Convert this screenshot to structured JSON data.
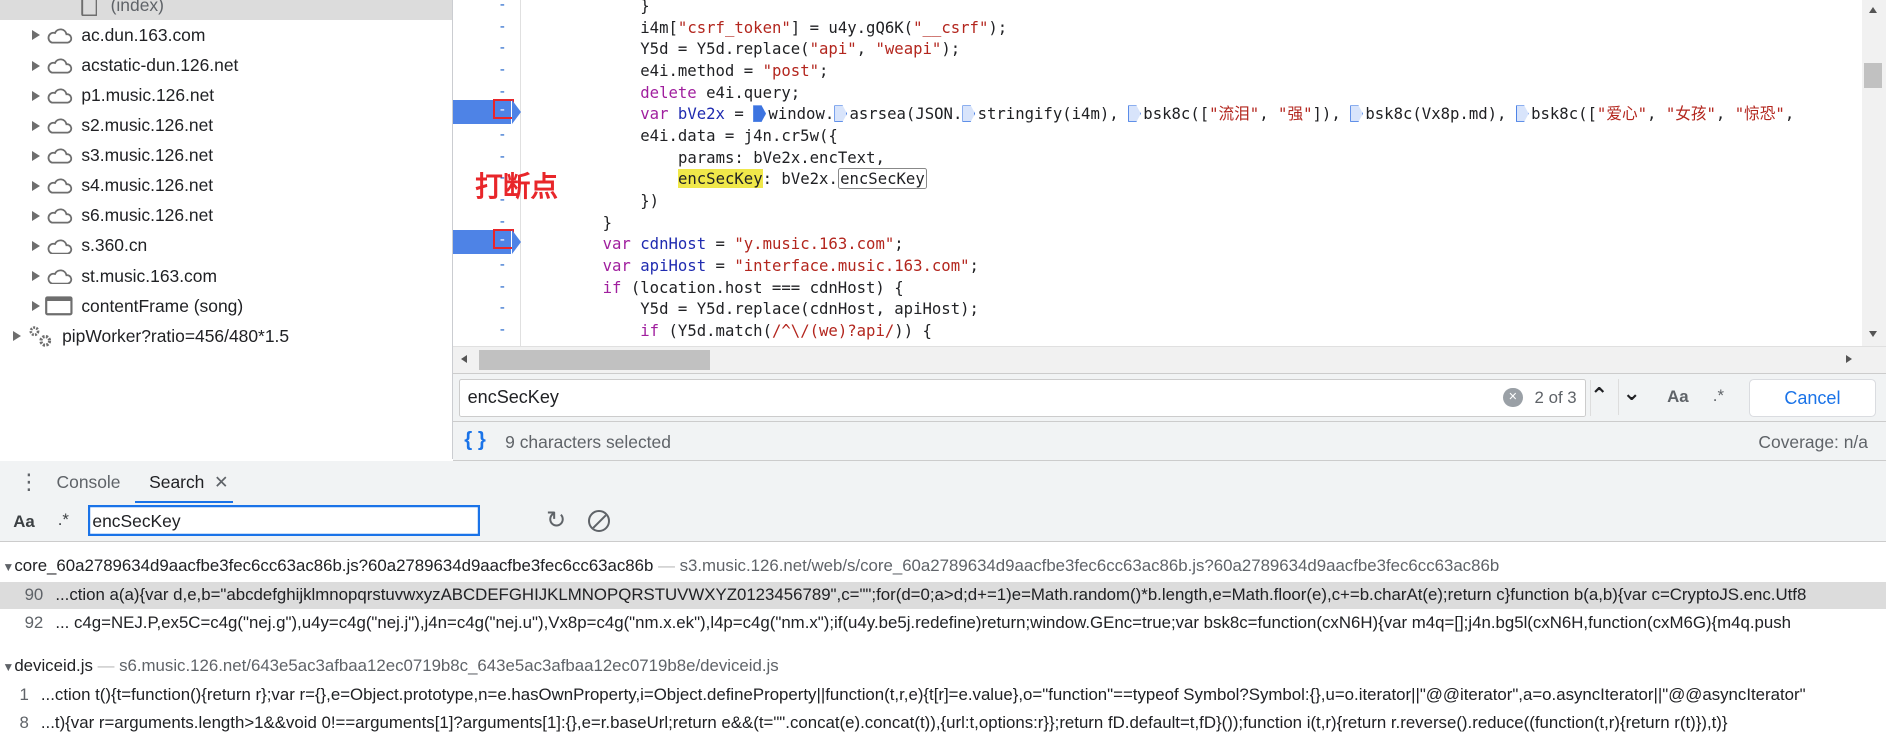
{
  "sidebar": {
    "items": [
      {
        "label": "(index)",
        "icon": "file-icon",
        "selected": true
      },
      {
        "label": "ac.dun.163.com",
        "icon": "cloud-icon"
      },
      {
        "label": "acstatic-dun.126.net",
        "icon": "cloud-icon"
      },
      {
        "label": "p1.music.126.net",
        "icon": "cloud-icon"
      },
      {
        "label": "s2.music.126.net",
        "icon": "cloud-icon"
      },
      {
        "label": "s3.music.126.net",
        "icon": "cloud-icon"
      },
      {
        "label": "s4.music.126.net",
        "icon": "cloud-icon"
      },
      {
        "label": "s6.music.126.net",
        "icon": "cloud-icon"
      },
      {
        "label": "s.360.cn",
        "icon": "cloud-icon"
      },
      {
        "label": "st.music.163.com",
        "icon": "cloud-icon"
      },
      {
        "label": "contentFrame (song)",
        "icon": "frame-icon"
      },
      {
        "label": "pipWorker?ratio=456/480*1.5",
        "icon": "gears-icon"
      }
    ]
  },
  "editor": {
    "annotation": "打断点",
    "lines": [
      {
        "indent": 4,
        "tokens": [
          [
            "",
            "}"
          ]
        ]
      },
      {
        "indent": 4,
        "tokens": [
          [
            "",
            "i4m["
          ],
          [
            "str",
            "\"csrf_token\""
          ],
          [
            "",
            "] = u4y.gQ6K("
          ],
          [
            "str",
            "\"__csrf\""
          ],
          [
            "",
            ");"
          ]
        ]
      },
      {
        "indent": 4,
        "tokens": [
          [
            "",
            "Y5d = Y5d.replace("
          ],
          [
            "str",
            "\"api\""
          ],
          [
            "",
            ", "
          ],
          [
            "str",
            "\"weapi\""
          ],
          [
            "",
            ");"
          ]
        ]
      },
      {
        "indent": 4,
        "tokens": [
          [
            "",
            "e4i.method = "
          ],
          [
            "str",
            "\"post\""
          ],
          [
            "",
            ";"
          ]
        ]
      },
      {
        "indent": 4,
        "tokens": [
          [
            "kw",
            "delete"
          ],
          [
            "",
            " e4i.query;"
          ]
        ]
      },
      {
        "indent": 4,
        "breakpoint": true,
        "tokens": [
          [
            "kw",
            "var"
          ],
          [
            "",
            " "
          ],
          [
            "def",
            "bVe2x"
          ],
          [
            "",
            " = "
          ],
          [
            "bpon",
            ""
          ],
          [
            "",
            "window."
          ],
          [
            "bp",
            ""
          ],
          [
            "",
            "asrsea(JSON."
          ],
          [
            "bp",
            ""
          ],
          [
            "",
            "stringify(i4m), "
          ],
          [
            "bp",
            ""
          ],
          [
            "",
            "bsk8c(["
          ],
          [
            "str",
            "\"流泪\""
          ],
          [
            "",
            ", "
          ],
          [
            "str",
            "\"强\""
          ],
          [
            "",
            "]), "
          ],
          [
            "bp",
            ""
          ],
          [
            "",
            "bsk8c(Vx8p.md), "
          ],
          [
            "bp",
            ""
          ],
          [
            "",
            "bsk8c(["
          ],
          [
            "str",
            "\"爱心\""
          ],
          [
            "",
            ", "
          ],
          [
            "str",
            "\"女孩\""
          ],
          [
            "",
            ", "
          ],
          [
            "str",
            "\"惊恐\""
          ],
          [
            "",
            ", "
          ]
        ]
      },
      {
        "indent": 4,
        "tokens": [
          [
            "",
            "e4i.data = j4n.cr5w({"
          ]
        ]
      },
      {
        "indent": 8,
        "tokens": [
          [
            "",
            "params: bVe2x.encText,"
          ]
        ]
      },
      {
        "indent": 8,
        "tokens": [
          [
            "hl",
            "encSecKey"
          ],
          [
            "",
            ": bVe2x."
          ],
          [
            "box",
            "encSecKey"
          ]
        ]
      },
      {
        "indent": 4,
        "tokens": [
          [
            "",
            "})"
          ]
        ]
      },
      {
        "indent": 0,
        "tokens": [
          [
            "",
            "}"
          ]
        ]
      },
      {
        "indent": 0,
        "breakpoint": true,
        "tokens": [
          [
            "kw",
            "var"
          ],
          [
            "",
            " "
          ],
          [
            "def",
            "cdnHost"
          ],
          [
            "",
            " = "
          ],
          [
            "str",
            "\"y.music.163.com\""
          ],
          [
            "",
            ";"
          ]
        ]
      },
      {
        "indent": 0,
        "tokens": [
          [
            "kw",
            "var"
          ],
          [
            "",
            " "
          ],
          [
            "def",
            "apiHost"
          ],
          [
            "",
            " = "
          ],
          [
            "str",
            "\"interface.music.163.com\""
          ],
          [
            "",
            ";"
          ]
        ]
      },
      {
        "indent": 0,
        "tokens": [
          [
            "kw",
            "if"
          ],
          [
            "",
            " (location.host === cdnHost) {"
          ]
        ]
      },
      {
        "indent": 4,
        "tokens": [
          [
            "",
            "Y5d = Y5d.replace(cdnHost, apiHost);"
          ]
        ]
      },
      {
        "indent": 4,
        "tokens": [
          [
            "kw",
            "if"
          ],
          [
            "",
            " (Y5d.match("
          ],
          [
            "str",
            "/^\\/(we)?api/"
          ],
          [
            "",
            ")) {"
          ]
        ]
      }
    ]
  },
  "find": {
    "query": "encSecKey",
    "match_count": "2 of 3",
    "case_label": "Aa",
    "regex_label": ".*",
    "cancel_label": "Cancel"
  },
  "status": {
    "selection": "9 characters selected",
    "coverage": "Coverage: n/a"
  },
  "drawer": {
    "tabs": [
      {
        "label": "Console"
      },
      {
        "label": "Search",
        "active": true,
        "closable": true
      }
    ],
    "search": {
      "case_label": "Aa",
      "regex_label": ".*",
      "query": "encSecKey"
    },
    "results": [
      {
        "file": "core_60a2789634d9aacfbe3fec6cc63ac86b.js?60a2789634d9aacfbe3fec6cc63ac86b",
        "url": "s3.music.126.net/web/s/core_60a2789634d9aacfbe3fec6cc63ac86b.js?60a2789634d9aacfbe3fec6cc63ac86b",
        "matches": [
          {
            "line": "90",
            "text": "...ction a(a){var d,e,b=\"abcdefghijklmnopqrstuvwxyzABCDEFGHIJKLMNOPQRSTUVWXYZ0123456789\",c=\"\";for(d=0;a>d;d+=1)e=Math.random()*b.length,e=Math.floor(e),c+=b.charAt(e);return c}function b(a,b){var c=CryptoJS.enc.Utf8",
            "selected": true
          },
          {
            "line": "92",
            "text": "... c4g=NEJ.P,ex5C=c4g(\"nej.g\"),u4y=c4g(\"nej.j\"),j4n=c4g(\"nej.u\"),Vx8p=c4g(\"nm.x.ek\"),l4p=c4g(\"nm.x\");if(u4y.be5j.redefine)return;window.GEnc=true;var bsk8c=function(cxN6H){var m4q=[];j4n.bg5l(cxN6H,function(cxM6G){m4q.push"
          }
        ]
      },
      {
        "file": "deviceid.js",
        "url": "s6.music.126.net/643e5ac3afbaa12ec0719b8c_643e5ac3afbaa12ec0719b8e/deviceid.js",
        "matches": [
          {
            "line": "1",
            "text": "...ction t(){t=function(){return r};var r={},e=Object.prototype,n=e.hasOwnProperty,i=Object.defineProperty||function(t,r,e){t[r]=e.value},o=\"function\"==typeof Symbol?Symbol:{},u=o.iterator||\"@@iterator\",a=o.asyncIterator||\"@@asyncIterator\""
          },
          {
            "line": "8",
            "text": "...t){var r=arguments.length>1&&void 0!==arguments[1]?arguments[1]:{},e=r.baseUrl;return e&&(t=\"\".concat(e).concat(t)),{url:t,options:r}};return fD.default=t,fD}());function i(t,r){return r.reverse().reduce((function(t,r){return r(t)}),t)}"
          }
        ]
      }
    ]
  },
  "colors": {
    "accent": "#1a73e8",
    "breakpoint": "#4e83e6",
    "annotation": "#e8262a",
    "highlight": "#f0e84a"
  }
}
